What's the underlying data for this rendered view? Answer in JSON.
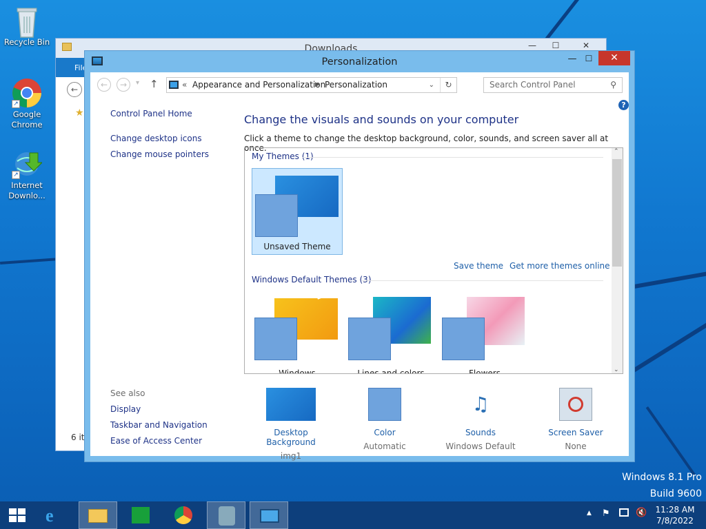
{
  "desktop": {
    "icons": [
      {
        "label": "Recycle Bin"
      },
      {
        "label": "Google\nChrome"
      },
      {
        "label": "Internet\nDownlo..."
      }
    ],
    "watermark": {
      "line1": "Windows 8.1 Pro",
      "line2": "Build 9600"
    }
  },
  "background_window": {
    "title": "Downloads",
    "ribbon_tab": "File",
    "status": "6 ite"
  },
  "window": {
    "title": "Personalization",
    "breadcrumb": {
      "prefix": "«",
      "items": [
        "Appearance and Personalization",
        "Personalization"
      ]
    },
    "search_placeholder": "Search Control Panel",
    "left_nav": {
      "home": "Control Panel Home",
      "links": [
        "Change desktop icons",
        "Change mouse pointers"
      ],
      "see_also_label": "See also",
      "see_also": [
        "Display",
        "Taskbar and Navigation",
        "Ease of Access Center"
      ]
    },
    "heading": "Change the visuals and sounds on your computer",
    "subtext": "Click a theme to change the desktop background, color, sounds, and screen saver all at once.",
    "gallery": {
      "my_themes_label": "My Themes (1)",
      "my_themes": [
        {
          "name": "Unsaved Theme",
          "selected": true
        }
      ],
      "save_theme": "Save theme",
      "get_more": "Get more themes online",
      "default_label": "Windows Default Themes (3)",
      "default_themes": [
        {
          "name": "Windows"
        },
        {
          "name": "Lines and colors"
        },
        {
          "name": "Flowers"
        }
      ]
    },
    "bottom": [
      {
        "name": "Desktop Background",
        "value": "img1"
      },
      {
        "name": "Color",
        "value": "Automatic"
      },
      {
        "name": "Sounds",
        "value": "Windows Default"
      },
      {
        "name": "Screen Saver",
        "value": "None"
      }
    ]
  },
  "taskbar": {
    "time": "11:28 AM",
    "date": "7/8/2022"
  },
  "colors": {
    "accent": "#79bcec",
    "link": "#1e3287",
    "close": "#c7362b",
    "taskbar": "#0d3f7c"
  }
}
